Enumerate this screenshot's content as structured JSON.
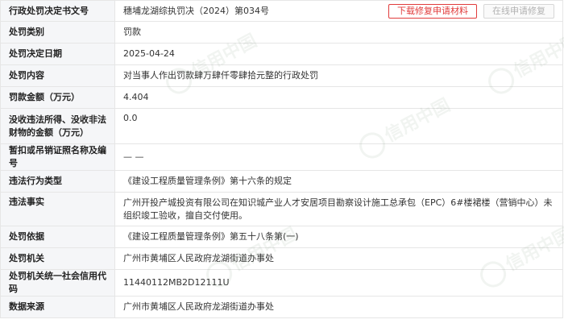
{
  "actions": {
    "download_label": "下载修复申请材料",
    "online_label": "在线申请修复"
  },
  "rows": [
    {
      "label": "行政处罚决定书文号",
      "value": "穗埔龙湖综执罚决（2024）第034号"
    },
    {
      "label": "处罚类别",
      "value": "罚款"
    },
    {
      "label": "处罚决定日期",
      "value": "2025-04-24"
    },
    {
      "label": "处罚内容",
      "value": "对当事人作出罚款肆万肆仟零肆拾元整的行政处罚"
    },
    {
      "label": "罚款金额（万元）",
      "value": "4.404"
    },
    {
      "label": "没收违法所得、没收非法财物的金额（万元）",
      "value": "0.0"
    },
    {
      "label": "暂扣或吊销证照名称及编号",
      "value": "— —"
    },
    {
      "label": "违法行为类型",
      "value": "《建设工程质量管理条例》第十六条的规定"
    },
    {
      "label": "违法事实",
      "value": "广州开投产城投资有限公司在知识城产业人才安居项目勘察设计施工总承包（EPC）6#楼裙楼（营销中心）未组织竣工验收，擅自交付使用。"
    },
    {
      "label": "处罚依据",
      "value": "《建设工程质量管理条例》第五十八条第(一)"
    },
    {
      "label": "处罚机关",
      "value": "广州市黄埔区人民政府龙湖街道办事处"
    },
    {
      "label": "处罚机关统一社会信用代码",
      "value": "11440112MB2D12111U"
    },
    {
      "label": "数据来源",
      "value": "广州市黄埔区人民政府龙湖街道办事处"
    }
  ],
  "watermark": "信用中国"
}
